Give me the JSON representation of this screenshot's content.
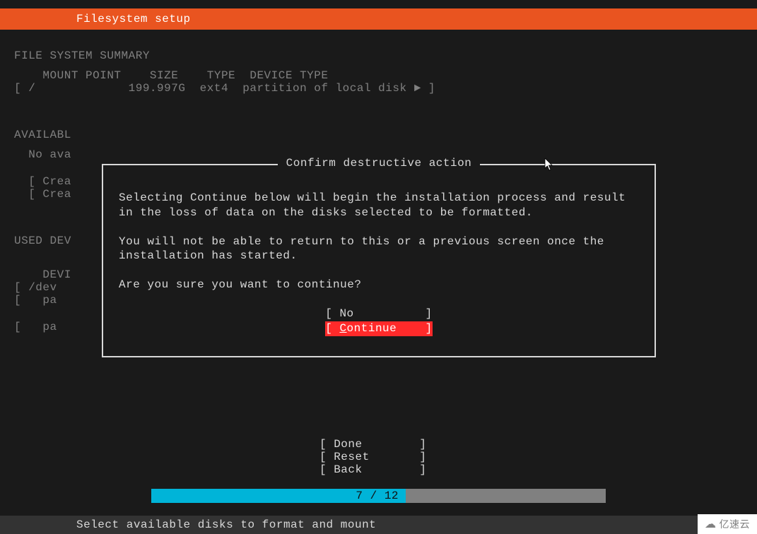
{
  "header": {
    "title": "Filesystem setup"
  },
  "summary": {
    "title": "FILE SYSTEM SUMMARY",
    "columns": "    MOUNT POINT    SIZE    TYPE  DEVICE TYPE",
    "row1": "[ /             199.997G  ext4  partition of local disk ► ]"
  },
  "available": {
    "title": "AVAILABL",
    "row1": "  No ava",
    "row2": "  [ Crea",
    "row3": "  [ Crea"
  },
  "used": {
    "title": "USED DEV",
    "row1": "    DEVI",
    "row2": "[ /dev",
    "row3": "[   pa",
    "row4": "[   pa"
  },
  "dialog": {
    "title": "Confirm destructive action",
    "para1": "Selecting Continue below will begin the installation process and result in the loss of data on the disks selected to be formatted.",
    "para2": "You will not be able to return to this or a previous screen once the installation has started.",
    "para3": "Are you sure you want to continue?",
    "no_label": "[ No          ]",
    "continue_left": "[ ",
    "continue_letter": "C",
    "continue_rest": "ontinue    ]"
  },
  "footer": {
    "done": "[ Done        ]",
    "reset": "[ Reset       ]",
    "back": "[ Back        ]",
    "progress_text": "7 / 12 ",
    "progress_percent": 56
  },
  "hint": {
    "text": "Select available disks to format and mount"
  },
  "watermark": {
    "text": "亿速云"
  }
}
